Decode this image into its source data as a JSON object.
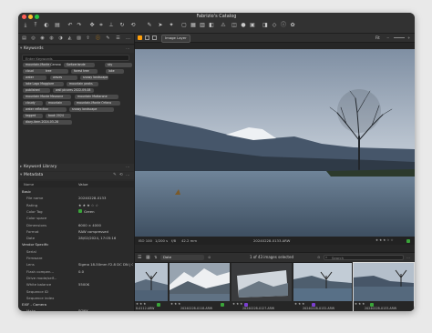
{
  "window": {
    "title": "Fabrizio's Catalog"
  },
  "colors": {
    "green": "#3aa53a",
    "purple": "#7b3fd1",
    "accent": "#4d8fd8"
  },
  "viewer": {
    "layer": "Image Layer",
    "fit": "Fit"
  },
  "panels": {
    "keywords_title": "Keywords",
    "keyword_library_title": "Keyword Library",
    "metadata_title": "Metadata",
    "keyword_placeholder": "Enter Keywords",
    "keywords": [
      "mountain-Monte Cerano",
      "Switzerlande",
      "sky",
      "cloud",
      "tree",
      "forest tree",
      "lake",
      "water",
      "waves",
      "snowy landscape",
      "lake Lago Maggiore",
      "mountain peaks",
      "published",
      "wall picures 2022-09-08",
      "mountain Monte Mezzone",
      "mountain Mottarone",
      "cloudy",
      "mountain",
      "mountain-Monte Orfano",
      "water reflection",
      "snowy landscape",
      "tagged",
      "book 2024",
      "diary-item-2024-03-28"
    ]
  },
  "metadata": {
    "col_name": "Name",
    "col_value": "Value",
    "rows": [
      {
        "k": "Basic",
        "v": "",
        "group": true
      },
      {
        "k": "File name",
        "v": "20240228-0133"
      },
      {
        "k": "Rating",
        "v": "★ ★ ★ ☆ ☆"
      },
      {
        "k": "Color Tag",
        "v": "Green"
      },
      {
        "k": "Color space",
        "v": ""
      },
      {
        "k": "Dimensions",
        "v": "6000 × 4000"
      },
      {
        "k": "Format",
        "v": "RAW compressed"
      },
      {
        "k": "Date",
        "v": "28/02/2024, 17:05:16"
      },
      {
        "k": "Vendor Specific",
        "v": "",
        "group": true
      },
      {
        "k": "Serial",
        "v": ""
      },
      {
        "k": "Firmware",
        "v": ""
      },
      {
        "k": "Lens",
        "v": "Sigma 18-50mm F2.8 DC DN | C (Sony E)"
      },
      {
        "k": "Flash compen...",
        "v": "0.0"
      },
      {
        "k": "Drive mode/self...",
        "v": ""
      },
      {
        "k": "White balance",
        "v": "5500K"
      },
      {
        "k": "Sequence ID",
        "v": ""
      },
      {
        "k": "Sequence index",
        "v": ""
      },
      {
        "k": "EXIF - Camera",
        "v": "",
        "group": true
      },
      {
        "k": "Make",
        "v": "SONY"
      }
    ]
  },
  "status": {
    "iso": "ISO 100",
    "shutter": "1/200 s",
    "aperture": "f/8",
    "focal": "42.2 mm",
    "filename": "20240228-0133.ARW"
  },
  "browser": {
    "sort": "Date",
    "count": "1 of 43 images selected",
    "search_placeholder": "Search"
  },
  "thumbs": [
    {
      "name": "8-0112.ARW",
      "rating": 3,
      "tag": "green"
    },
    {
      "name": "20240228-0118.ARW",
      "rating": 3,
      "tag": "green"
    },
    {
      "name": "20240228-0127.ARW",
      "rating": 3,
      "tag": "purple"
    },
    {
      "name": "20240228-0132.ARW",
      "rating": 3,
      "tag": "purple"
    },
    {
      "name": "20240228-0133.ARW",
      "rating": 3,
      "tag": "green"
    }
  ]
}
